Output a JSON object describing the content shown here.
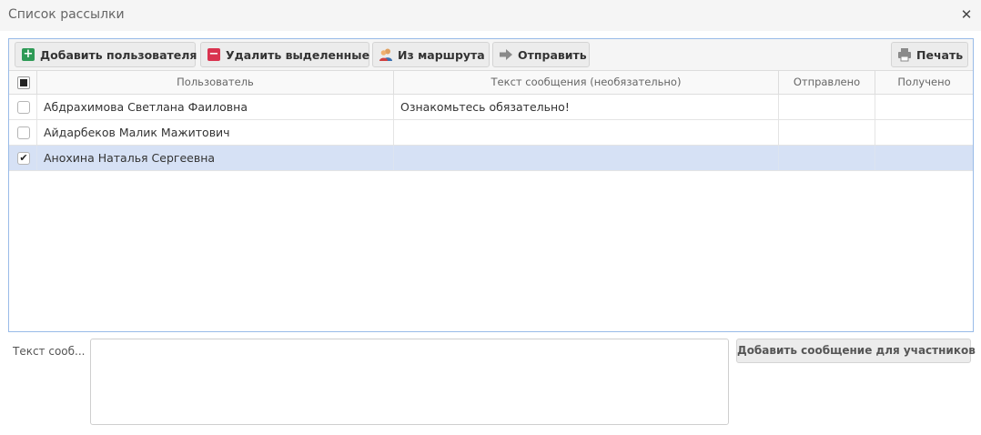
{
  "window": {
    "title": "Список рассылки",
    "close_glyph": "✕"
  },
  "toolbar": {
    "add_user_label": "Добавить пользователя",
    "add_user_icon": "plus-square-icon",
    "delete_selected_label": "Удалить выделенные",
    "delete_selected_icon": "minus-square-icon",
    "from_route_label": "Из маршрута",
    "from_route_icon": "users-icon",
    "send_label": "Отправить",
    "send_icon": "arrow-right-icon",
    "print_label": "Печать",
    "print_icon": "printer-icon"
  },
  "grid": {
    "columns": [
      "Пользователь",
      "Текст сообщения (необязательно)",
      "Отправлено",
      "Получено"
    ],
    "rows": [
      {
        "user": "Абдрахимова Светлана Фаиловна",
        "message": "Ознакомьтесь обязательно!",
        "sent": "",
        "received": "",
        "checked": false,
        "check_glyph": ""
      },
      {
        "user": "Айдарбеков Малик Мажитович",
        "message": "",
        "sent": "",
        "received": "",
        "checked": false,
        "check_glyph": ""
      },
      {
        "user": "Анохина Наталья Сергеевна",
        "message": "",
        "sent": "",
        "received": "",
        "checked": true,
        "check_glyph": "✔"
      }
    ]
  },
  "bottom": {
    "message_label": "Текст сооб...",
    "message_value": "",
    "add_message_button": "Добавить сообщение для участников"
  },
  "colors": {
    "add_green": "#2e9a56",
    "delete_red": "#d9334f",
    "send_gray": "#8a8a8a",
    "selected_row": "#d6e1f5",
    "panel_border": "#99bbe8"
  }
}
